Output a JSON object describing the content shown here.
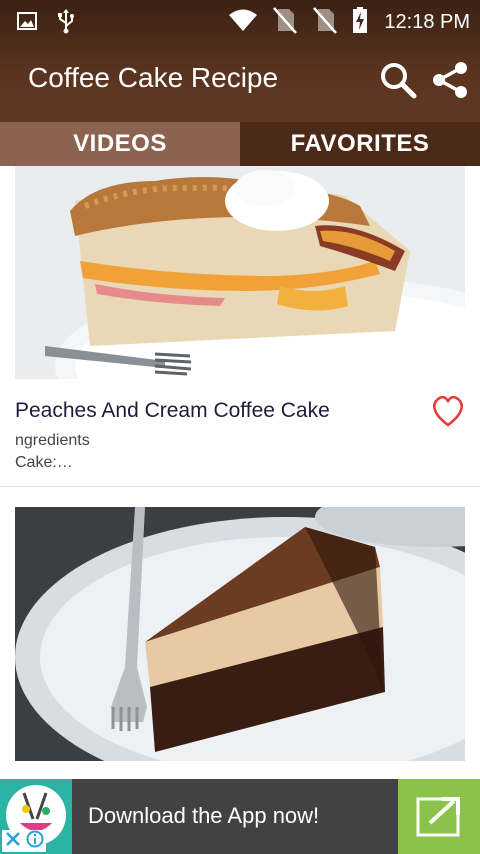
{
  "status_bar": {
    "time": "12:18 PM",
    "icons": [
      "image-icon",
      "usb-icon",
      "wifi-icon",
      "no-sim-icon",
      "no-sim-icon",
      "battery-charging-icon"
    ]
  },
  "app_bar": {
    "title": "Coffee Cake Recipe",
    "actions": [
      "search-icon",
      "share-icon"
    ]
  },
  "tabs": [
    {
      "label": "VIDEOS",
      "selected": false
    },
    {
      "label": "FAVORITES",
      "selected": true
    }
  ],
  "feed": {
    "items": [
      {
        "title": "Peaches And Cream Coffee Cake",
        "subtitle_line1": "ngredients",
        "subtitle_line2": "Cake:…",
        "favorite": true,
        "image": "peach-coffee-cake-photo"
      },
      {
        "image": "mocha-layer-cake-photo"
      }
    ]
  },
  "ad_banner": {
    "text": "Download the App now!",
    "colors": {
      "background": "#424242",
      "icon_bg": "#2bb3a4",
      "button_bg": "#8bc34a"
    }
  },
  "colors": {
    "header_dark": "#3b2114",
    "tab_unselected": "#8c6250",
    "tab_selected": "#4c2a18",
    "heart": "#e53935",
    "title_text": "#1e1e3c"
  }
}
